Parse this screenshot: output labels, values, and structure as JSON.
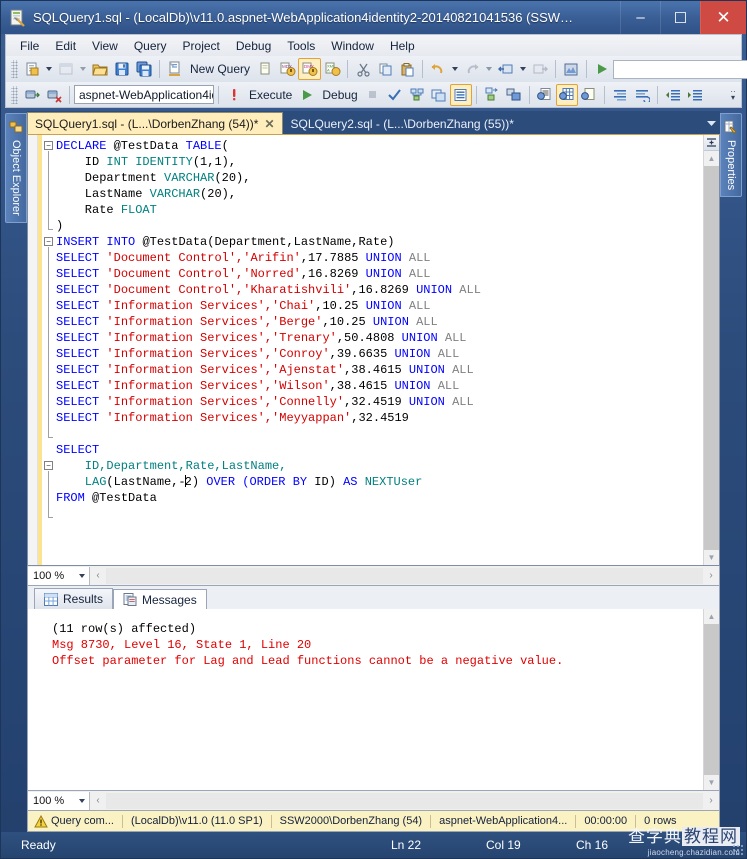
{
  "window": {
    "title": "SQLQuery1.sql - (LocalDb)\\v11.0.aspnet-WebApplication4identity2-20140821041536 (SSW…",
    "minimize": "–",
    "maximize": "☐",
    "close": "✕",
    "app_icon": "sql-query-file-icon"
  },
  "menu": {
    "items": [
      {
        "label": "File"
      },
      {
        "label": "Edit"
      },
      {
        "label": "View"
      },
      {
        "label": "Query"
      },
      {
        "label": "Project"
      },
      {
        "label": "Debug"
      },
      {
        "label": "Tools"
      },
      {
        "label": "Window"
      },
      {
        "label": "Help"
      }
    ]
  },
  "toolbar_main": {
    "new_query_label": "New Query",
    "buttons": [
      "new-item-dropdown-button",
      "new-project-dropdown-button",
      "open-file-button",
      "save-button",
      "save-all-button",
      "new-query-button",
      "new-database-engine-query-button",
      "new-analysis-mdx-query-button",
      "new-analysis-dmx-query-button",
      "new-analysis-xmla-query-button",
      "cut-button",
      "copy-button",
      "paste-button",
      "undo-button",
      "redo-button",
      "navigate-backward-button",
      "navigate-forward-button",
      "registered-servers-button",
      "start-debugging-button"
    ],
    "combo_value": ""
  },
  "toolbar_query": {
    "database_value": "aspnet-WebApplication4ide",
    "execute_label": "Execute",
    "debug_label": "Debug",
    "buttons": [
      "connect-button",
      "disconnect-button",
      "available-databases-combo",
      "execute-button",
      "debug-button",
      "stop-button",
      "parse-button",
      "display-estimated-execution-plan-button",
      "query-options-button",
      "include-actual-execution-plan-button",
      "include-client-statistics-button",
      "results-to-text-button",
      "results-to-grid-button",
      "results-to-file-button",
      "comment-lines-button",
      "uncomment-lines-button",
      "decrease-indent-button",
      "increase-indent-button"
    ]
  },
  "dock_left": {
    "label": "Object Explorer",
    "icon": "object-explorer-icon"
  },
  "dock_right": {
    "label": "Properties",
    "icon": "properties-icon"
  },
  "document_tabs": {
    "tabs": [
      {
        "label": "SQLQuery1.sql - (L...\\DorbenZhang (54))*",
        "active": true,
        "close": "✕"
      },
      {
        "label": "SQLQuery2.sql - (L...\\DorbenZhang (55))*",
        "active": false
      }
    ],
    "dropdown_icon": "chevron-down-icon"
  },
  "editor": {
    "zoom": "100 %",
    "lines": [
      [
        {
          "t": "DECLARE ",
          "c": "kw"
        },
        {
          "t": "@TestData ",
          "c": "pl"
        },
        {
          "t": "TABLE",
          "c": "kw"
        },
        {
          "t": "(",
          "c": "pl"
        }
      ],
      [
        {
          "t": "    ID ",
          "c": "pl"
        },
        {
          "t": "INT ",
          "c": "dt"
        },
        {
          "t": "IDENTITY",
          "c": "dt"
        },
        {
          "t": "(1,1),",
          "c": "pl"
        }
      ],
      [
        {
          "t": "    Department ",
          "c": "pl"
        },
        {
          "t": "VARCHAR",
          "c": "dt"
        },
        {
          "t": "(20),",
          "c": "pl"
        }
      ],
      [
        {
          "t": "    LastName ",
          "c": "pl"
        },
        {
          "t": "VARCHAR",
          "c": "dt"
        },
        {
          "t": "(20),",
          "c": "pl"
        }
      ],
      [
        {
          "t": "    Rate ",
          "c": "pl"
        },
        {
          "t": "FLOAT",
          "c": "dt"
        }
      ],
      [
        {
          "t": ")",
          "c": "pl"
        }
      ],
      [
        {
          "t": "INSERT ",
          "c": "kw"
        },
        {
          "t": "INTO ",
          "c": "kw"
        },
        {
          "t": "@TestData(Department,LastName,Rate)",
          "c": "pl"
        }
      ],
      [
        {
          "t": "SELECT ",
          "c": "kw"
        },
        {
          "t": "'Document Control','Arifin'",
          "c": "str"
        },
        {
          "t": ",17.7885 ",
          "c": "pl"
        },
        {
          "t": "UNION ",
          "c": "kw"
        },
        {
          "t": "ALL",
          "c": "gray"
        }
      ],
      [
        {
          "t": "SELECT ",
          "c": "kw"
        },
        {
          "t": "'Document Control','Norred'",
          "c": "str"
        },
        {
          "t": ",16.8269 ",
          "c": "pl"
        },
        {
          "t": "UNION ",
          "c": "kw"
        },
        {
          "t": "ALL",
          "c": "gray"
        }
      ],
      [
        {
          "t": "SELECT ",
          "c": "kw"
        },
        {
          "t": "'Document Control','Kharatishvili'",
          "c": "str"
        },
        {
          "t": ",16.8269 ",
          "c": "pl"
        },
        {
          "t": "UNION ",
          "c": "kw"
        },
        {
          "t": "ALL",
          "c": "gray"
        }
      ],
      [
        {
          "t": "SELECT ",
          "c": "kw"
        },
        {
          "t": "'Information Services','Chai'",
          "c": "str"
        },
        {
          "t": ",10.25 ",
          "c": "pl"
        },
        {
          "t": "UNION ",
          "c": "kw"
        },
        {
          "t": "ALL",
          "c": "gray"
        }
      ],
      [
        {
          "t": "SELECT ",
          "c": "kw"
        },
        {
          "t": "'Information Services','Berge'",
          "c": "str"
        },
        {
          "t": ",10.25 ",
          "c": "pl"
        },
        {
          "t": "UNION ",
          "c": "kw"
        },
        {
          "t": "ALL",
          "c": "gray"
        }
      ],
      [
        {
          "t": "SELECT ",
          "c": "kw"
        },
        {
          "t": "'Information Services','Trenary'",
          "c": "str"
        },
        {
          "t": ",50.4808 ",
          "c": "pl"
        },
        {
          "t": "UNION ",
          "c": "kw"
        },
        {
          "t": "ALL",
          "c": "gray"
        }
      ],
      [
        {
          "t": "SELECT ",
          "c": "kw"
        },
        {
          "t": "'Information Services','Conroy'",
          "c": "str"
        },
        {
          "t": ",39.6635 ",
          "c": "pl"
        },
        {
          "t": "UNION ",
          "c": "kw"
        },
        {
          "t": "ALL",
          "c": "gray"
        }
      ],
      [
        {
          "t": "SELECT ",
          "c": "kw"
        },
        {
          "t": "'Information Services','Ajenstat'",
          "c": "str"
        },
        {
          "t": ",38.4615 ",
          "c": "pl"
        },
        {
          "t": "UNION ",
          "c": "kw"
        },
        {
          "t": "ALL",
          "c": "gray"
        }
      ],
      [
        {
          "t": "SELECT ",
          "c": "kw"
        },
        {
          "t": "'Information Services','Wilson'",
          "c": "str"
        },
        {
          "t": ",38.4615 ",
          "c": "pl"
        },
        {
          "t": "UNION ",
          "c": "kw"
        },
        {
          "t": "ALL",
          "c": "gray"
        }
      ],
      [
        {
          "t": "SELECT ",
          "c": "kw"
        },
        {
          "t": "'Information Services','Connelly'",
          "c": "str"
        },
        {
          "t": ",32.4519 ",
          "c": "pl"
        },
        {
          "t": "UNION ",
          "c": "kw"
        },
        {
          "t": "ALL",
          "c": "gray"
        }
      ],
      [
        {
          "t": "SELECT ",
          "c": "kw"
        },
        {
          "t": "'Information Services','Meyyappan'",
          "c": "str"
        },
        {
          "t": ",32.4519",
          "c": "pl"
        }
      ],
      [],
      [
        {
          "t": "SELECT",
          "c": "kw"
        }
      ],
      [
        {
          "t": "    ID,Department,Rate,LastName,",
          "c": "dt"
        }
      ],
      [
        {
          "t": "    LAG",
          "c": "dt"
        },
        {
          "t": "(LastName,-",
          "c": "pl"
        },
        {
          "t": "CURSOR",
          "c": "caret"
        },
        {
          "t": "2) ",
          "c": "pl"
        },
        {
          "t": "OVER ",
          "c": "kw"
        },
        {
          "t": "(ORDER ",
          "c": "kw"
        },
        {
          "t": "BY ",
          "c": "kw"
        },
        {
          "t": "ID) ",
          "c": "pl"
        },
        {
          "t": "AS ",
          "c": "kw"
        },
        {
          "t": "NEXTUser",
          "c": "dt"
        }
      ],
      [
        {
          "t": "FROM ",
          "c": "kw"
        },
        {
          "t": "@TestData",
          "c": "pl"
        }
      ]
    ]
  },
  "results": {
    "tabs": [
      {
        "label": "Results",
        "icon": "grid-icon",
        "active": false
      },
      {
        "label": "Messages",
        "icon": "messages-icon",
        "active": true
      }
    ],
    "messages": [
      {
        "text": "(11 row(s) affected)",
        "error": false
      },
      {
        "text": "Msg 8730, Level 16, State 1, Line 20",
        "error": true
      },
      {
        "text": "Offset parameter for Lag and Lead functions cannot be a negative value.",
        "error": true
      }
    ],
    "zoom": "100 %"
  },
  "query_status": {
    "icon": "warning-icon",
    "message": "Query com...",
    "server": "(LocalDb)\\v11.0 (11.0 SP1)",
    "user": "SSW2000\\DorbenZhang (54)",
    "database": "aspnet-WebApplication4...",
    "time": "00:00:00",
    "rows": "0 rows"
  },
  "statusbar": {
    "ready": "Ready",
    "line": "Ln 22",
    "column": "Col 19",
    "char": "Ch 16",
    "watermark_cn": "查字典",
    "watermark_cn2": "教程网",
    "watermark_url": "jiaocheng.chazidian.com"
  },
  "colors": {
    "accent_blue": "#2f517f",
    "keyword": "#0000ff",
    "string": "#d40000",
    "datatype": "#008080",
    "error": "#e00000",
    "tab_active": "#ffeebb",
    "status_yellow": "#fbf2c4"
  }
}
